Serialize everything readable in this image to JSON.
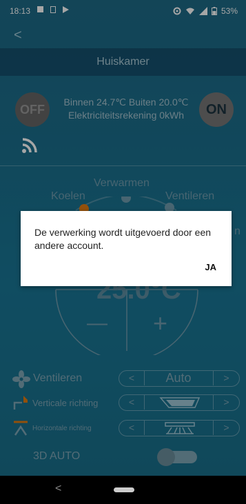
{
  "status_bar": {
    "time": "18:13",
    "battery": "53%"
  },
  "header": {
    "title": "Huiskamer",
    "back": "<"
  },
  "power": {
    "off_label": "OFF",
    "on_label": "ON"
  },
  "info": {
    "line1": "Binnen 24.7℃  Buiten 20.0℃",
    "line2": "Elektriciteitsrekening 0kWh"
  },
  "modes": {
    "heat": "Verwarmen",
    "cool": "Koelen",
    "fan": "Ventileren",
    "partial": "n"
  },
  "temperature": {
    "value": "25.0°C",
    "minus": "—",
    "plus": "+"
  },
  "controls": {
    "fan_label": "Ventileren",
    "fan_value": "Auto",
    "vertical_label": "Verticale richting",
    "horizontal_label": "Horizontale richting",
    "prev": "<",
    "next": ">",
    "auto3d_label": "3D AUTO"
  },
  "dialog": {
    "message": "De verwerking wordt uitgevoerd door een andere account.",
    "confirm": "JA"
  },
  "nav": {
    "back": "<"
  }
}
